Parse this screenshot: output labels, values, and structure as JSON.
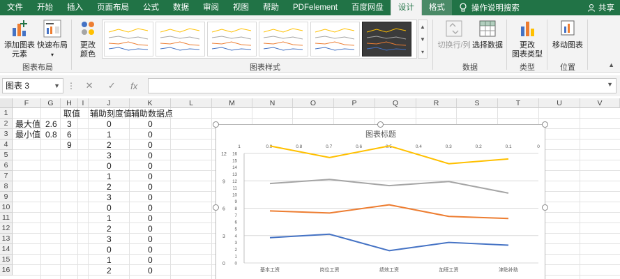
{
  "tabs": [
    "文件",
    "开始",
    "插入",
    "页面布局",
    "公式",
    "数据",
    "审阅",
    "视图",
    "帮助",
    "PDFelement",
    "百度网盘",
    "设计",
    "格式"
  ],
  "active_tab": "设计",
  "tell_me": "操作说明搜索",
  "share": "共享",
  "ribbon": {
    "add_element": [
      "添加图表",
      "元素"
    ],
    "quick_layout": "快速布局",
    "change_colors": [
      "更改",
      "颜色"
    ],
    "group_layout": "图表布局",
    "group_styles": "图表样式",
    "switch_row_col": "切换行/列",
    "select_data": "选择数据",
    "group_data": "数据",
    "change_type": [
      "更改",
      "图表类型"
    ],
    "group_type": "类型",
    "move_chart": "移动图表",
    "group_location": "位置"
  },
  "name_box": "图表 3",
  "columns": [
    "F",
    "G",
    "H",
    "I",
    "J",
    "K",
    "L",
    "M",
    "N",
    "O",
    "P",
    "Q",
    "R",
    "S",
    "T",
    "U",
    "V"
  ],
  "rows": [
    "1",
    "2",
    "3",
    "4",
    "5",
    "6",
    "7",
    "8",
    "9",
    "10",
    "11",
    "12",
    "13",
    "14",
    "15",
    "16"
  ],
  "cells": {
    "h1": "取值",
    "j1": "辅助刻度值",
    "k1": "辅助数据点",
    "f2": "最大值",
    "g2": "2.6",
    "h2": "3",
    "f3": "最小值",
    "g3": "0.8",
    "h3": "6",
    "h4": "9",
    "j_values": [
      "0",
      "1",
      "2",
      "3",
      "0",
      "1",
      "2",
      "3",
      "0",
      "1",
      "2",
      "3",
      "0",
      "1",
      "2"
    ],
    "k_values": [
      "0",
      "0",
      "0",
      "0",
      "0",
      "0",
      "0",
      "0",
      "0",
      "0",
      "0",
      "0",
      "0",
      "0",
      "0"
    ]
  },
  "colors": {
    "excel_green": "#217346",
    "series_blue": "#4472c4",
    "series_orange": "#ed7d31",
    "series_gray": "#a5a5a5",
    "series_yellow": "#ffc000"
  },
  "chart_data": {
    "type": "line",
    "title": "图表标题",
    "categories": [
      "基本工资",
      "岗位工资",
      "绩效工资",
      "加班工资",
      "津贴补助"
    ],
    "left_axis_primary": [
      "0",
      "3",
      "6",
      "9",
      "12"
    ],
    "left_axis_secondary": [
      "0",
      "1",
      "2",
      "3",
      "4",
      "5",
      "6",
      "7",
      "8",
      "9",
      "10",
      "11",
      "12",
      "13",
      "14",
      "15",
      "16"
    ],
    "top_axis": [
      "1",
      "0.9",
      "0.8",
      "0.7",
      "0.6",
      "0.5",
      "0.4",
      "0.3",
      "0.2",
      "0.1",
      "0"
    ],
    "ylim": [
      0,
      16
    ],
    "series": [
      {
        "values": [
          3.7,
          4.2,
          1.8,
          3.0,
          2.6
        ],
        "color": "#4472c4"
      },
      {
        "values": [
          7.6,
          7.3,
          8.5,
          6.8,
          6.5
        ],
        "color": "#ed7d31"
      },
      {
        "values": [
          11.6,
          12.2,
          11.3,
          11.9,
          10.2
        ],
        "color": "#a5a5a5"
      },
      {
        "values": [
          17.1,
          15.4,
          17.1,
          14.5,
          15.2
        ],
        "color": "#ffc000"
      }
    ]
  }
}
